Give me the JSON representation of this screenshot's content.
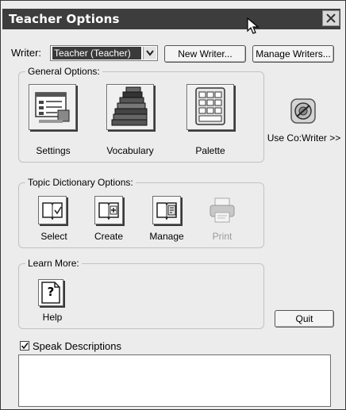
{
  "window": {
    "title": "Teacher Options"
  },
  "writer": {
    "label": "Writer:",
    "selected": "Teacher (Teacher)"
  },
  "buttons": {
    "new_writer": "New Writer...",
    "manage_writers": "Manage Writers...",
    "quit": "Quit"
  },
  "general": {
    "legend": "General Options:",
    "items": [
      {
        "label": "Settings",
        "icon": "settings-icon"
      },
      {
        "label": "Vocabulary",
        "icon": "books-icon"
      },
      {
        "label": "Palette",
        "icon": "palette-icon"
      }
    ]
  },
  "use_cowriter": {
    "label": "Use Co:Writer >>",
    "icon": "cowriter-icon"
  },
  "topic": {
    "legend": "Topic Dictionary Options:",
    "items": [
      {
        "label": "Select",
        "icon": "select-book-icon"
      },
      {
        "label": "Create",
        "icon": "create-book-icon"
      },
      {
        "label": "Manage",
        "icon": "manage-book-icon"
      },
      {
        "label": "Print",
        "icon": "printer-icon"
      }
    ]
  },
  "learn": {
    "legend": "Learn More:",
    "help_label": "Help",
    "help_glyph": "?"
  },
  "speak": {
    "label": "Speak Descriptions",
    "checked": true
  },
  "colors": {
    "titlebar": "#3d3d3d",
    "window_bg": "#ececec",
    "selection": "#3a3a3a"
  }
}
